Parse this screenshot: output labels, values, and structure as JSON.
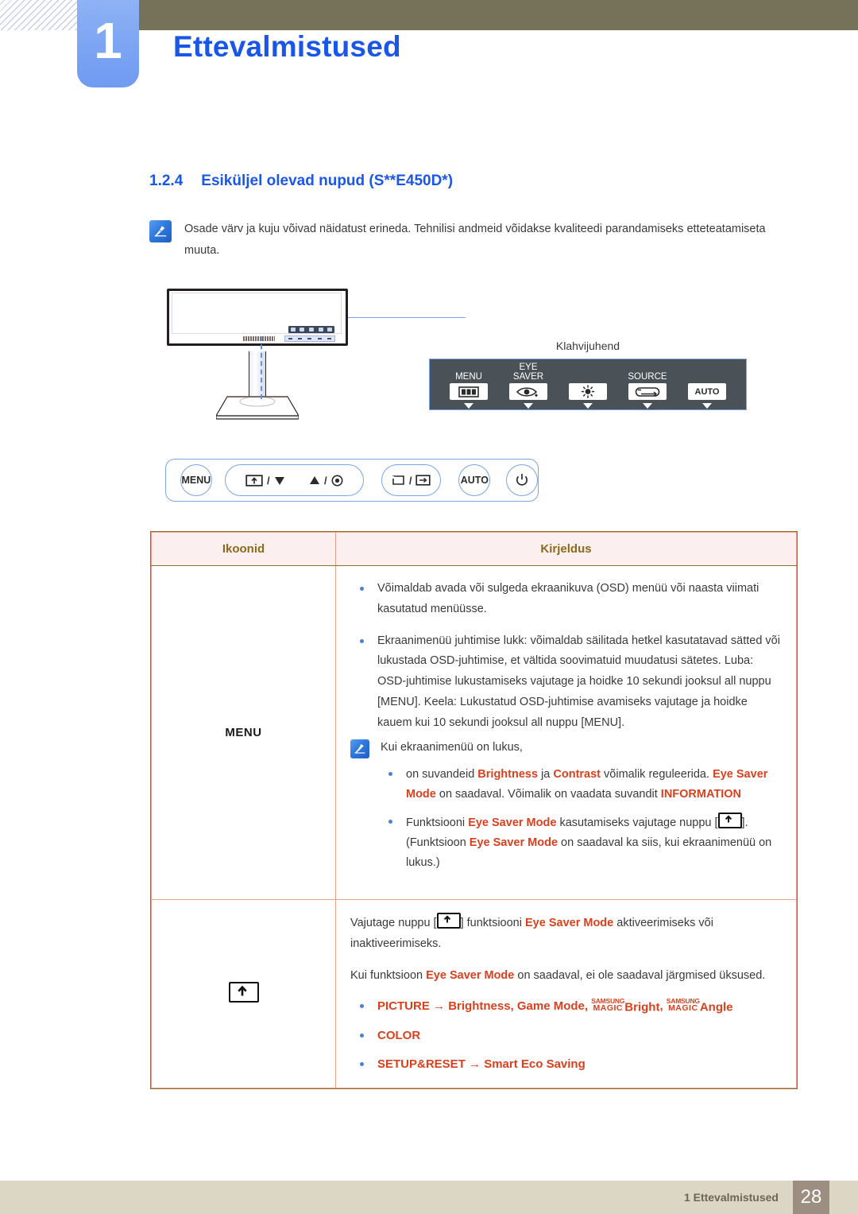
{
  "header": {
    "chapter_number": "1",
    "chapter_title": "Ettevalmistused"
  },
  "section": {
    "number": "1.2.4",
    "title": "Esiküljel olevad nupud (S**E450D*)"
  },
  "note": {
    "icon": "note-icon",
    "text": "Osade värv ja kuju võivad näidatust erineda. Tehnilisi andmeid võidakse kvaliteedi parandamiseks etteteatamiseta muuta."
  },
  "diagram": {
    "key_guide_label": "Klahvijuhend",
    "key_guide_items": [
      {
        "caption": "MENU",
        "icon": "menu-bars-icon"
      },
      {
        "caption": "EYE\nSAVER",
        "icon": "eye-saver-icon"
      },
      {
        "caption": "",
        "icon": "brightness-icon"
      },
      {
        "caption": "SOURCE",
        "icon": "source-icon"
      },
      {
        "caption": "",
        "icon": "auto-icon",
        "label": "AUTO"
      }
    ],
    "front_buttons": [
      {
        "label": "MENU",
        "icon": "menu-button"
      },
      {
        "label": "",
        "icon": "eye-saver-down-button"
      },
      {
        "label": "",
        "icon": "up-brightness-button"
      },
      {
        "label": "",
        "icon": "source-enter-button"
      },
      {
        "label": "AUTO",
        "icon": "auto-button"
      },
      {
        "label": "",
        "icon": "power-icon"
      }
    ]
  },
  "table": {
    "headers": {
      "col1": "Ikoonid",
      "col2": "Kirjeldus"
    },
    "rows": [
      {
        "icon_label": "MENU",
        "bullets": [
          "Võimaldab avada või sulgeda ekraanikuva (OSD) menüü või naasta viimati kasutatud menüüsse.",
          "Ekraanimenüü juhtimise lukk: võimaldab säilitada hetkel kasutatavad sätted või lukustada OSD-juhtimise, et vältida soovimatuid muudatusi sätetes. Luba: OSD-juhtimise lukustamiseks vajutage ja hoidke 10 sekundi jooksul all nuppu [MENU]. Keela: Lukustatud OSD-juhtimise avamiseks vajutage ja hoidke kauem kui 10 sekundi jooksul all nuppu [MENU]."
        ],
        "subnote": {
          "title": "Kui ekraanimenüü on lukus,",
          "items": [
            {
              "pre": "on suvandeid ",
              "hl1": "Brightness",
              "mid1": " ja ",
              "hl2": "Contrast",
              "mid2": " võimalik reguleerida. ",
              "hl3": "Eye Saver Mode",
              "mid3": " on saadaval. Võimalik on vaadata suvandit ",
              "hl4": "INFORMATION"
            },
            {
              "pre": "Funktsiooni ",
              "hl1": "Eye Saver Mode",
              "mid1": " kasutamiseks vajutage nuppu [",
              "key": "up-arrow-box",
              "mid2": "]. (Funktsioon ",
              "hl2": "Eye Saver Mode",
              "mid3": " on saadaval ka siis, kui ekraanimenüü on lukus.)"
            }
          ]
        }
      },
      {
        "icon_label": "",
        "icon": "up-arrow-box-icon",
        "para1_pre": "Vajutage nuppu [",
        "para1_key": "up-arrow-box",
        "para1_mid": "] funktsiooni ",
        "para1_hl": "Eye Saver Mode",
        "para1_post": " aktiveerimiseks või inaktiveerimiseks.",
        "para2_pre": "Kui funktsioon ",
        "para2_hl": "Eye Saver Mode",
        "para2_post": " on saadaval, ei ole saadaval järgmised üksused.",
        "list": [
          {
            "main": "PICTURE",
            "arrow": "→",
            "rest": "Brightness, Game Mode, ",
            "magic1_top": "SAMSUNG",
            "magic1_bottom": "MAGIC",
            "magic1_word": "Bright",
            "sep": ", ",
            "magic2_top": "SAMSUNG",
            "magic2_bottom": "MAGIC",
            "magic2_word": "Angle"
          },
          {
            "main": "COLOR",
            "arrow": "",
            "rest": ""
          },
          {
            "main": "SETUP&RESET",
            "arrow": "→",
            "rest": "Smart Eco Saving"
          }
        ]
      }
    ]
  },
  "footer": {
    "text": "1 Ettevalmistused",
    "page": "28"
  },
  "colors": {
    "accent_blue": "#1a56e8",
    "olive": "#767259",
    "tab_blue": "#7ca4f3",
    "table_border": "#8a7028",
    "table_inner": "#eda08d",
    "table_head_bg": "#fcefef",
    "highlight_red": "#d8411e",
    "footer_bg": "#dcd6c4",
    "footer_page_bg": "#9c8f81"
  }
}
